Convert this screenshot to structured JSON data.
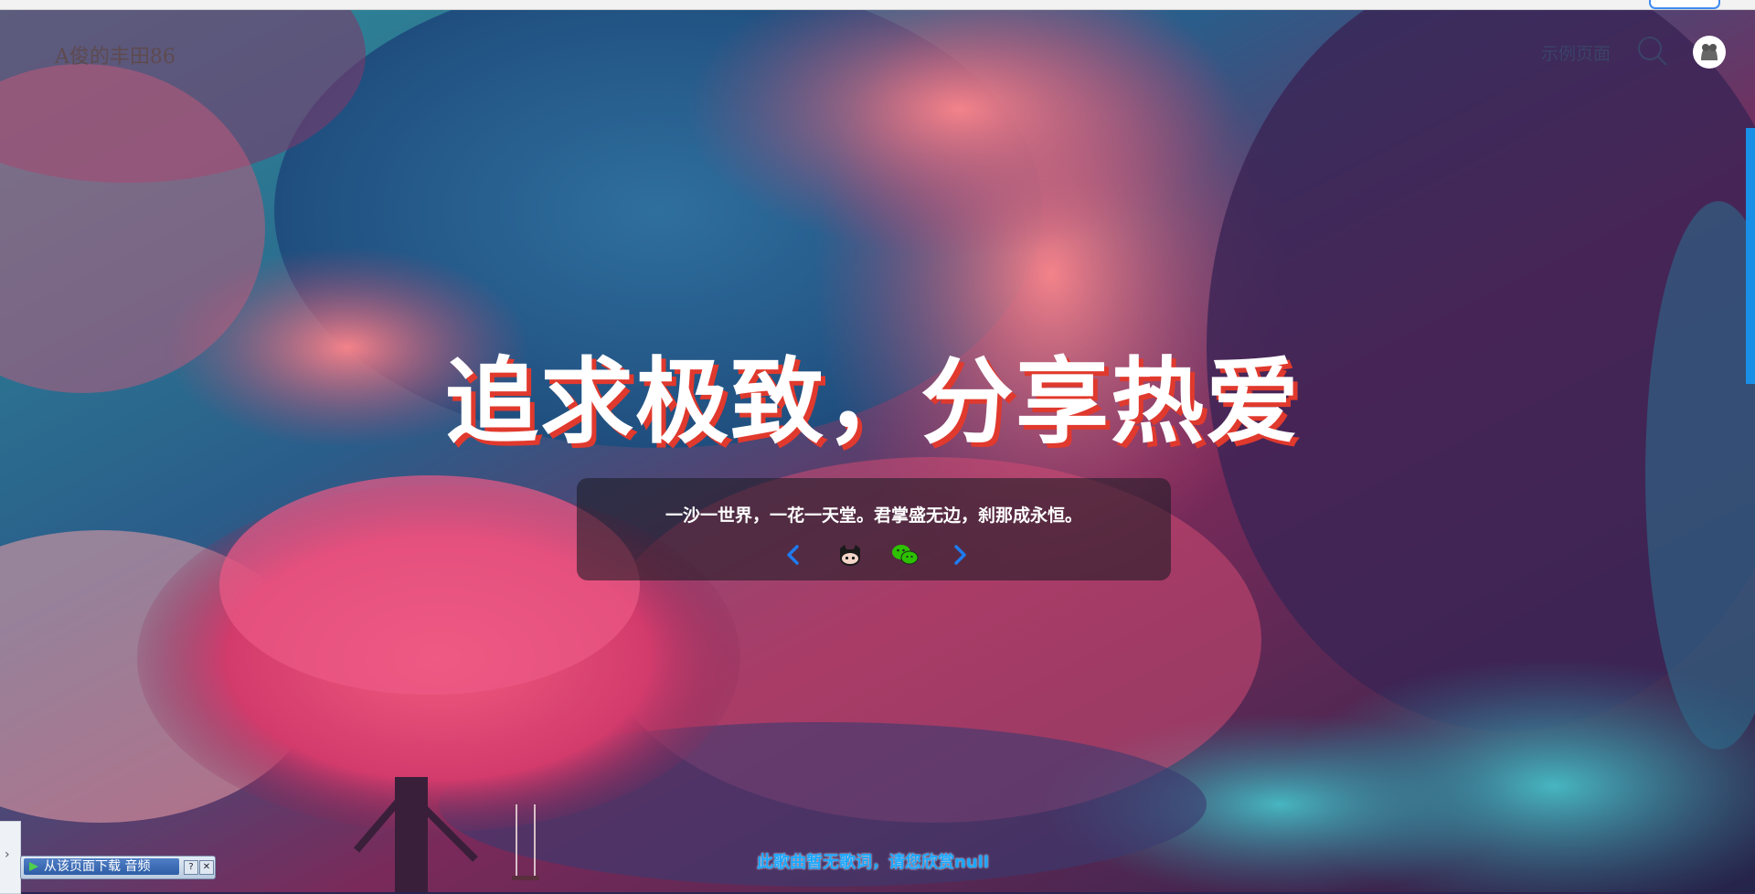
{
  "header": {
    "site_title": "A俊的丰田86",
    "nav_link": "示例页面",
    "search_icon": "search-icon",
    "avatar_icon": "avatar-icon"
  },
  "hero": {
    "headline": "追求极致，分享热爱",
    "quote": "一沙一世界，一花一天堂。君掌盛无边，刹那成永恒。",
    "social_icons": [
      "chevron-left-icon",
      "github-icon",
      "wechat-icon",
      "chevron-right-icon"
    ]
  },
  "player": {
    "lyrics": "此歌曲暂无歌词，请您欣赏null",
    "side_tab_glyph": "›"
  },
  "download_bar": {
    "label": "从该页面下载 音频",
    "help": "?",
    "close": "✕"
  },
  "colors": {
    "accent_red": "#e0392d",
    "lyrics_blue": "#1aa7ff",
    "wechat_green": "#2dc100",
    "chevron_blue": "#1e7bf0"
  }
}
